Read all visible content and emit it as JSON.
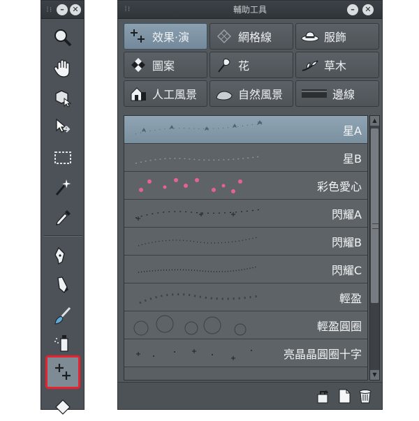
{
  "tool_palette": {
    "grip_label": "⁞⁝",
    "minimize_label": "–",
    "close_label": "✕",
    "tools": [
      {
        "icon": "zoom-icon"
      },
      {
        "icon": "hand-icon"
      },
      {
        "icon": "object-select-icon"
      },
      {
        "icon": "move-layer-icon"
      },
      {
        "icon": "selection-marquee-icon"
      },
      {
        "icon": "auto-select-wand-icon"
      },
      {
        "icon": "eyedropper-icon"
      },
      {
        "icon": "pen-icon"
      },
      {
        "icon": "pencil-icon"
      },
      {
        "icon": "brush-icon"
      },
      {
        "icon": "airbrush-icon"
      },
      {
        "icon": "decoration-sparkle-icon",
        "active": true
      },
      {
        "icon": "eraser-icon"
      }
    ],
    "highlight_color": "#e8212f"
  },
  "sub_tool_panel": {
    "title": "輔助工具",
    "grip_label": "⁞⁝",
    "groups": [
      {
        "label": "效果·演",
        "icon": "effect-sparkle-icon",
        "selected": true
      },
      {
        "label": "網格線",
        "icon": "mesh-icon"
      },
      {
        "label": "服飾",
        "icon": "clothing-hat-icon"
      },
      {
        "label": "圖案",
        "icon": "pattern-icon"
      },
      {
        "label": "花",
        "icon": "flower-icon"
      },
      {
        "label": "草木",
        "icon": "plant-icon"
      },
      {
        "label": "人工風景",
        "icon": "house-icon"
      },
      {
        "label": "自然風景",
        "icon": "rock-icon"
      },
      {
        "label": "邊線",
        "icon": "border-line-icon"
      }
    ],
    "brushes": [
      {
        "name": "星A",
        "selected": true
      },
      {
        "name": "星B"
      },
      {
        "name": "彩色愛心"
      },
      {
        "name": "閃耀A"
      },
      {
        "name": "閃耀B"
      },
      {
        "name": "閃耀C"
      },
      {
        "name": "輕盈"
      },
      {
        "name": "輕盈圓圈"
      },
      {
        "name": "亮晶晶圓圈十字"
      }
    ],
    "scroll_up": "▲",
    "scroll_down": "▼",
    "selection_color": "#8fa4b4"
  }
}
